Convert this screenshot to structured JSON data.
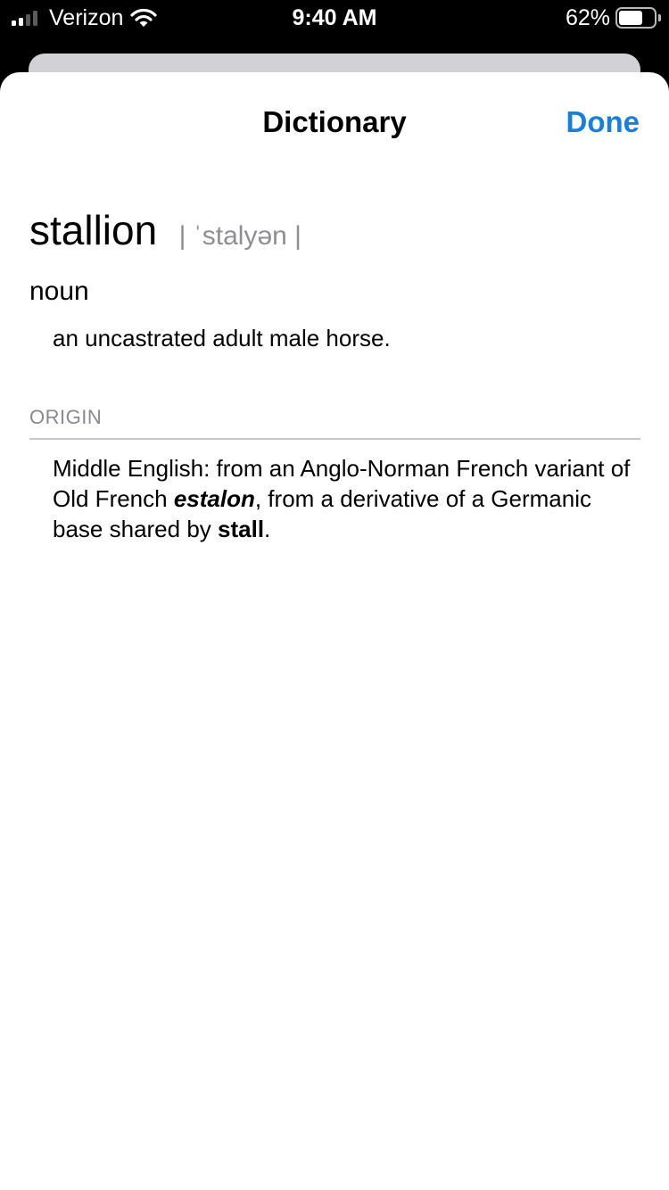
{
  "status_bar": {
    "carrier": "Verizon",
    "time": "9:40 AM",
    "battery_percent": "62%",
    "battery_level": 0.62,
    "signal_bars": 2,
    "icons": [
      "signal-icon",
      "wifi-icon",
      "battery-icon"
    ]
  },
  "nav": {
    "title": "Dictionary",
    "done_label": "Done",
    "accent_color": "#1a7fdb"
  },
  "entry": {
    "headword": "stallion",
    "pronunciation": "| ˈstalyən |",
    "part_of_speech": "noun",
    "definition": "an uncastrated adult male horse.",
    "origin_label": "ORIGIN",
    "origin": {
      "part1": "Middle English: from an Anglo-Norman French variant of Old French ",
      "term1": "estalon",
      "part2": ", from a derivative of a Germanic base shared by ",
      "term2": "stall",
      "part3": "."
    }
  }
}
